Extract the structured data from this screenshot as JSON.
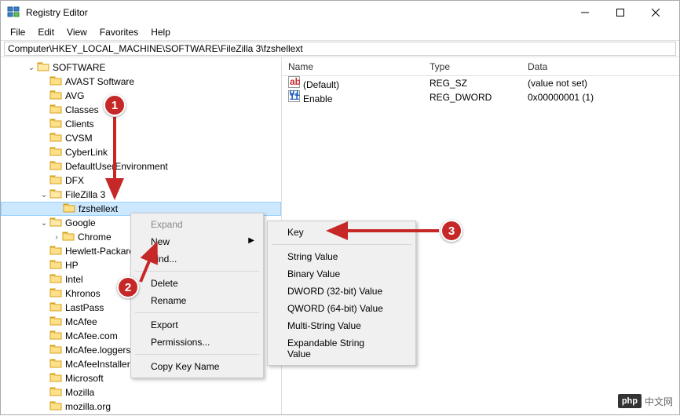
{
  "window": {
    "title": "Registry Editor"
  },
  "menu": {
    "file": "File",
    "edit": "Edit",
    "view": "View",
    "favorites": "Favorites",
    "help": "Help"
  },
  "address": "Computer\\HKEY_LOCAL_MACHINE\\SOFTWARE\\FileZilla 3\\fzshellext",
  "tree": {
    "items": [
      {
        "depth": 2,
        "exp": "open",
        "label": "SOFTWARE"
      },
      {
        "depth": 3,
        "exp": "none",
        "label": "AVAST Software"
      },
      {
        "depth": 3,
        "exp": "none",
        "label": "AVG"
      },
      {
        "depth": 3,
        "exp": "none",
        "label": "Classes"
      },
      {
        "depth": 3,
        "exp": "none",
        "label": "Clients"
      },
      {
        "depth": 3,
        "exp": "none",
        "label": "CVSM"
      },
      {
        "depth": 3,
        "exp": "none",
        "label": "CyberLink"
      },
      {
        "depth": 3,
        "exp": "none",
        "label": "DefaultUserEnvironment"
      },
      {
        "depth": 3,
        "exp": "none",
        "label": "DFX"
      },
      {
        "depth": 3,
        "exp": "open",
        "label": "FileZilla 3"
      },
      {
        "depth": 4,
        "exp": "none",
        "label": "fzshellext",
        "selected": true
      },
      {
        "depth": 3,
        "exp": "open",
        "label": "Google"
      },
      {
        "depth": 4,
        "exp": "closed",
        "label": "Chrome"
      },
      {
        "depth": 3,
        "exp": "none",
        "label": "Hewlett-Packard"
      },
      {
        "depth": 3,
        "exp": "none",
        "label": "HP"
      },
      {
        "depth": 3,
        "exp": "none",
        "label": "Intel"
      },
      {
        "depth": 3,
        "exp": "none",
        "label": "Khronos"
      },
      {
        "depth": 3,
        "exp": "none",
        "label": "LastPass"
      },
      {
        "depth": 3,
        "exp": "none",
        "label": "McAfee"
      },
      {
        "depth": 3,
        "exp": "none",
        "label": "McAfee.com"
      },
      {
        "depth": 3,
        "exp": "none",
        "label": "McAfee.loggers"
      },
      {
        "depth": 3,
        "exp": "none",
        "label": "McAfeeInstaller"
      },
      {
        "depth": 3,
        "exp": "none",
        "label": "Microsoft"
      },
      {
        "depth": 3,
        "exp": "none",
        "label": "Mozilla"
      },
      {
        "depth": 3,
        "exp": "none",
        "label": "mozilla.org"
      }
    ]
  },
  "list": {
    "headers": {
      "name": "Name",
      "type": "Type",
      "data": "Data"
    },
    "rows": [
      {
        "icon": "sz",
        "name": "(Default)",
        "type": "REG_SZ",
        "data": "(value not set)"
      },
      {
        "icon": "dw",
        "name": "Enable",
        "type": "REG_DWORD",
        "data": "0x00000001 (1)"
      }
    ]
  },
  "context_menu": {
    "expand": "Expand",
    "new": "New",
    "find": "Find...",
    "delete": "Delete",
    "rename": "Rename",
    "export": "Export",
    "permissions": "Permissions...",
    "copy_key_name": "Copy Key Name"
  },
  "submenu": {
    "key": "Key",
    "string": "String Value",
    "binary": "Binary Value",
    "dword": "DWORD (32-bit) Value",
    "qword": "QWORD (64-bit) Value",
    "multi": "Multi-String Value",
    "expand": "Expandable String Value"
  },
  "badges": {
    "b1": "1",
    "b2": "2",
    "b3": "3"
  },
  "watermark": {
    "logo": "php",
    "text": "中文网"
  }
}
